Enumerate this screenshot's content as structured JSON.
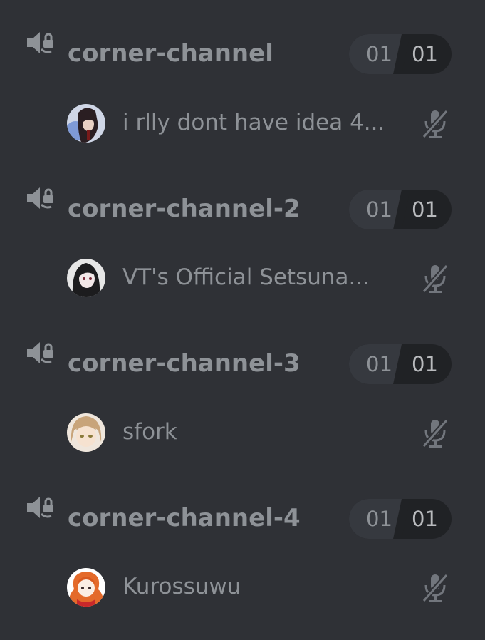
{
  "channels": [
    {
      "name": "corner-channel",
      "count_left": "01",
      "count_right": "01",
      "user": {
        "name": "i rlly dont have idea 4..."
      }
    },
    {
      "name": "corner-channel-2",
      "count_left": "01",
      "count_right": "01",
      "user": {
        "name": "VT's Official Setsuna..."
      }
    },
    {
      "name": "corner-channel-3",
      "count_left": "01",
      "count_right": "01",
      "user": {
        "name": "sfork"
      }
    },
    {
      "name": "corner-channel-4",
      "count_left": "01",
      "count_right": "01",
      "user": {
        "name": "Kurossuwu"
      }
    }
  ],
  "icons": {
    "channel": "speaker-with-lock-icon",
    "user_status": "microphone-muted-icon"
  },
  "colors": {
    "background": "#2f3136",
    "text_muted": "#8e9297",
    "counter_dark": "#202225",
    "counter_light": "#36393f"
  }
}
